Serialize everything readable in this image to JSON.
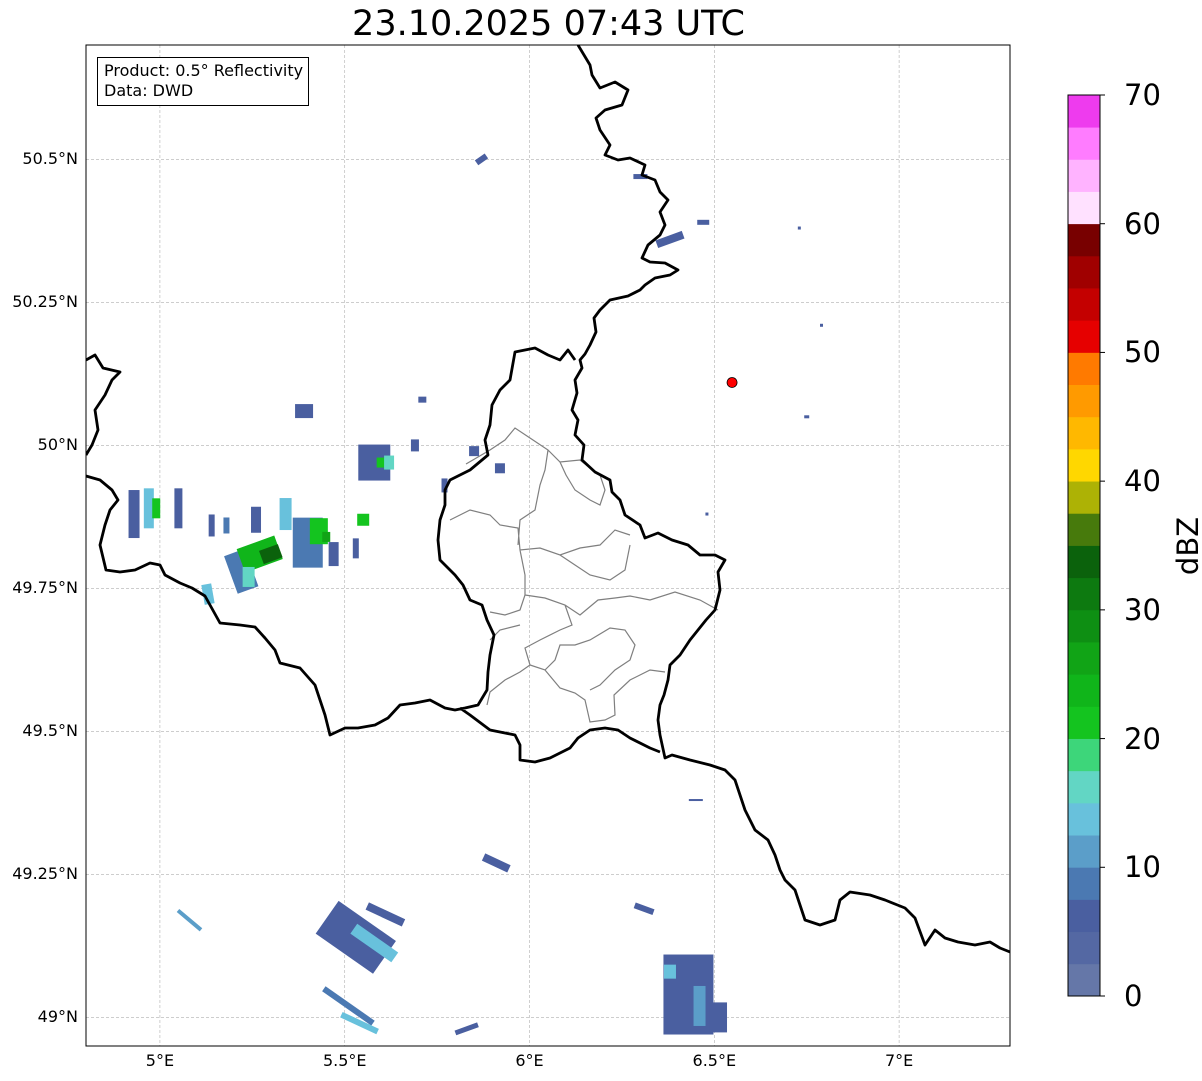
{
  "title": "23.10.2025 07:43 UTC",
  "info_box": {
    "line1": "Product: 0.5° Reflectivity",
    "line2": "Data: DWD"
  },
  "map": {
    "extent": {
      "lon_min": 4.8,
      "lon_max": 7.3,
      "lat_min": 48.95,
      "lat_max": 50.7
    },
    "lat_ticks": [
      {
        "value": 50.5,
        "label": "50.5°N"
      },
      {
        "value": 50.25,
        "label": "50.25°N"
      },
      {
        "value": 50.0,
        "label": "50°N"
      },
      {
        "value": 49.75,
        "label": "49.75°N"
      },
      {
        "value": 49.5,
        "label": "49.5°N"
      },
      {
        "value": 49.25,
        "label": "49.25°N"
      },
      {
        "value": 49.0,
        "label": "49°N"
      }
    ],
    "lon_ticks": [
      {
        "value": 5.0,
        "label": "5°E"
      },
      {
        "value": 5.5,
        "label": "5.5°E"
      },
      {
        "value": 6.0,
        "label": "6°E"
      },
      {
        "value": 6.5,
        "label": "6.5°E"
      },
      {
        "value": 7.0,
        "label": "7°E"
      }
    ],
    "radar_site": {
      "lon": 6.548,
      "lat": 50.11,
      "color": "#ff0000"
    },
    "gridlines": true
  },
  "colorbar": {
    "label": "dBZ",
    "min": 0,
    "max": 70,
    "step": 2.5,
    "ticks": [
      "0",
      "10",
      "20",
      "30",
      "40",
      "50",
      "60",
      "70"
    ],
    "colors": [
      "#6577a8",
      "#5468a3",
      "#4a5fa0",
      "#4b79b2",
      "#5b9ec9",
      "#68c1dc",
      "#62d6c4",
      "#3dd67a",
      "#14c41f",
      "#10b51a",
      "#11a416",
      "#0e8f13",
      "#0d7a10",
      "#0b620c",
      "#477a0c",
      "#adb205",
      "#ffd700",
      "#ffb800",
      "#ff9a00",
      "#ff7a00",
      "#e60000",
      "#c40000",
      "#a00000",
      "#780000",
      "#ffe1ff",
      "#ffb3ff",
      "#ff7cff",
      "#ee3bee"
    ]
  },
  "echoes": [
    {
      "lon": 4.93,
      "lat": 49.88,
      "w": 11,
      "h": 48,
      "dbz": 5,
      "angle": 0
    },
    {
      "lon": 4.97,
      "lat": 49.89,
      "w": 10,
      "h": 40,
      "dbz": 14,
      "angle": 0
    },
    {
      "lon": 4.99,
      "lat": 49.89,
      "w": 8,
      "h": 20,
      "dbz": 22,
      "angle": 0
    },
    {
      "lon": 5.05,
      "lat": 49.89,
      "w": 8,
      "h": 40,
      "dbz": 6,
      "angle": 0
    },
    {
      "lon": 5.14,
      "lat": 49.86,
      "w": 6,
      "h": 22,
      "dbz": 7,
      "angle": 0
    },
    {
      "lon": 5.18,
      "lat": 49.86,
      "w": 6,
      "h": 16,
      "dbz": 8,
      "angle": 0
    },
    {
      "lon": 5.22,
      "lat": 49.78,
      "w": 22,
      "h": 40,
      "dbz": 9,
      "angle": -20
    },
    {
      "lon": 5.27,
      "lat": 49.81,
      "w": 40,
      "h": 25,
      "dbz": 24,
      "angle": -20
    },
    {
      "lon": 5.3,
      "lat": 49.81,
      "w": 20,
      "h": 14,
      "dbz": 33,
      "angle": -20
    },
    {
      "lon": 5.26,
      "lat": 49.87,
      "w": 10,
      "h": 26,
      "dbz": 5,
      "angle": 0
    },
    {
      "lon": 5.34,
      "lat": 49.88,
      "w": 12,
      "h": 32,
      "dbz": 14,
      "angle": 0
    },
    {
      "lon": 5.4,
      "lat": 49.83,
      "w": 30,
      "h": 50,
      "dbz": 8,
      "angle": 0
    },
    {
      "lon": 5.43,
      "lat": 49.85,
      "w": 18,
      "h": 26,
      "dbz": 20,
      "angle": 0
    },
    {
      "lon": 5.45,
      "lat": 49.84,
      "w": 8,
      "h": 10,
      "dbz": 25,
      "angle": 0
    },
    {
      "lon": 5.47,
      "lat": 49.81,
      "w": 10,
      "h": 24,
      "dbz": 6,
      "angle": 0
    },
    {
      "lon": 5.53,
      "lat": 49.82,
      "w": 6,
      "h": 20,
      "dbz": 7,
      "angle": 0
    },
    {
      "lon": 5.55,
      "lat": 49.87,
      "w": 12,
      "h": 12,
      "dbz": 22,
      "angle": 0
    },
    {
      "lon": 5.24,
      "lat": 49.77,
      "w": 12,
      "h": 20,
      "dbz": 17,
      "angle": 0
    },
    {
      "lon": 5.13,
      "lat": 49.74,
      "w": 10,
      "h": 20,
      "dbz": 14,
      "angle": -10
    },
    {
      "lon": 5.58,
      "lat": 49.97,
      "w": 32,
      "h": 36,
      "dbz": 6,
      "angle": 0
    },
    {
      "lon": 5.6,
      "lat": 49.97,
      "w": 10,
      "h": 10,
      "dbz": 22,
      "angle": 0
    },
    {
      "lon": 5.62,
      "lat": 49.97,
      "w": 10,
      "h": 14,
      "dbz": 16,
      "angle": 0
    },
    {
      "lon": 5.69,
      "lat": 50.0,
      "w": 8,
      "h": 12,
      "dbz": 5,
      "angle": 0
    },
    {
      "lon": 5.77,
      "lat": 49.93,
      "w": 6,
      "h": 14,
      "dbz": 6,
      "angle": 0
    },
    {
      "lon": 5.39,
      "lat": 50.06,
      "w": 18,
      "h": 14,
      "dbz": 5,
      "angle": 0
    },
    {
      "lon": 5.71,
      "lat": 50.08,
      "w": 8,
      "h": 6,
      "dbz": 5,
      "angle": 0
    },
    {
      "lon": 5.85,
      "lat": 49.99,
      "w": 10,
      "h": 10,
      "dbz": 5,
      "angle": 0
    },
    {
      "lon": 5.92,
      "lat": 49.96,
      "w": 10,
      "h": 10,
      "dbz": 5,
      "angle": 0
    },
    {
      "lon": 5.87,
      "lat": 50.5,
      "w": 12,
      "h": 6,
      "dbz": 5,
      "angle": -35
    },
    {
      "lon": 6.3,
      "lat": 50.47,
      "w": 14,
      "h": 5,
      "dbz": 5,
      "angle": 0
    },
    {
      "lon": 6.38,
      "lat": 50.36,
      "w": 28,
      "h": 8,
      "dbz": 5,
      "angle": -20
    },
    {
      "lon": 6.47,
      "lat": 50.39,
      "w": 12,
      "h": 5,
      "dbz": 5,
      "angle": 0
    },
    {
      "lon": 5.91,
      "lat": 49.27,
      "w": 28,
      "h": 8,
      "dbz": 5,
      "angle": 25
    },
    {
      "lon": 5.53,
      "lat": 49.14,
      "w": 70,
      "h": 40,
      "dbz": 7,
      "angle": 35
    },
    {
      "lon": 5.58,
      "lat": 49.13,
      "w": 50,
      "h": 12,
      "dbz": 13,
      "angle": 35
    },
    {
      "lon": 5.61,
      "lat": 49.18,
      "w": 40,
      "h": 8,
      "dbz": 5,
      "angle": 25
    },
    {
      "lon": 5.51,
      "lat": 49.02,
      "w": 60,
      "h": 6,
      "dbz": 8,
      "angle": 35
    },
    {
      "lon": 5.54,
      "lat": 48.99,
      "w": 40,
      "h": 6,
      "dbz": 13,
      "angle": 25
    },
    {
      "lon": 5.83,
      "lat": 48.98,
      "w": 24,
      "h": 5,
      "dbz": 7,
      "angle": -20
    },
    {
      "lon": 5.08,
      "lat": 49.17,
      "w": 30,
      "h": 4,
      "dbz": 11,
      "angle": 40
    },
    {
      "lon": 6.31,
      "lat": 49.19,
      "w": 20,
      "h": 6,
      "dbz": 6,
      "angle": 20
    },
    {
      "lon": 6.43,
      "lat": 49.04,
      "w": 50,
      "h": 80,
      "dbz": 6,
      "angle": 0
    },
    {
      "lon": 6.46,
      "lat": 49.02,
      "w": 12,
      "h": 40,
      "dbz": 12,
      "angle": 0
    },
    {
      "lon": 6.38,
      "lat": 49.08,
      "w": 12,
      "h": 14,
      "dbz": 13,
      "angle": 0
    },
    {
      "lon": 6.51,
      "lat": 49.0,
      "w": 18,
      "h": 30,
      "dbz": 7,
      "angle": 0
    },
    {
      "lon": 6.79,
      "lat": 50.21,
      "w": 3,
      "h": 3,
      "dbz": 5,
      "angle": 0
    },
    {
      "lon": 6.75,
      "lat": 50.05,
      "w": 5,
      "h": 3,
      "dbz": 5,
      "angle": 0
    },
    {
      "lon": 6.73,
      "lat": 50.38,
      "w": 3,
      "h": 3,
      "dbz": 5,
      "angle": 0
    },
    {
      "lon": 6.48,
      "lat": 49.88,
      "w": 3,
      "h": 3,
      "dbz": 5,
      "angle": 0
    },
    {
      "lon": 6.45,
      "lat": 49.38,
      "w": 14,
      "h": 2,
      "dbz": 6,
      "angle": 0
    }
  ]
}
